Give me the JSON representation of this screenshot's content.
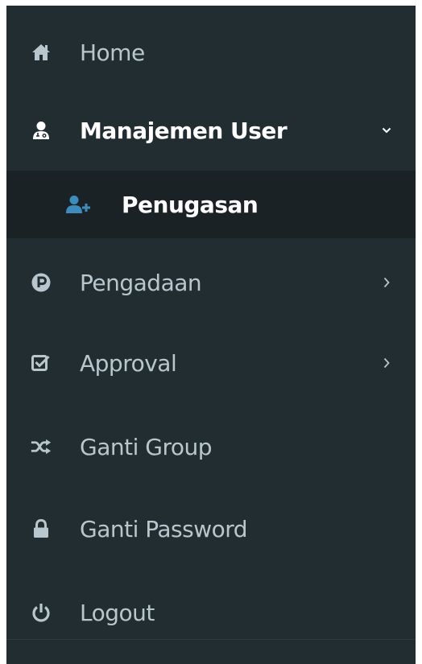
{
  "sidebar": {
    "items": [
      {
        "label": "Home",
        "icon": "home-icon"
      },
      {
        "label": "Manajemen User",
        "icon": "user-md-icon",
        "expanded": true,
        "children": [
          {
            "label": "Penugasan",
            "icon": "user-plus-icon",
            "active": true
          }
        ]
      },
      {
        "label": "Pengadaan",
        "icon": "circle-p-icon",
        "chevron": "chevron-right-icon"
      },
      {
        "label": "Approval",
        "icon": "check-square-icon",
        "chevron": "chevron-right-icon"
      },
      {
        "label": "Ganti Group",
        "icon": "random-icon"
      },
      {
        "label": "Ganti Password",
        "icon": "lock-icon"
      },
      {
        "label": "Logout",
        "icon": "power-icon"
      }
    ]
  },
  "colors": {
    "sidebar_bg": "#222d32",
    "submenu_bg": "#1a2226",
    "text": "#b8c7ce",
    "active_text": "#ffffff",
    "accent": "#3c8dbc"
  }
}
